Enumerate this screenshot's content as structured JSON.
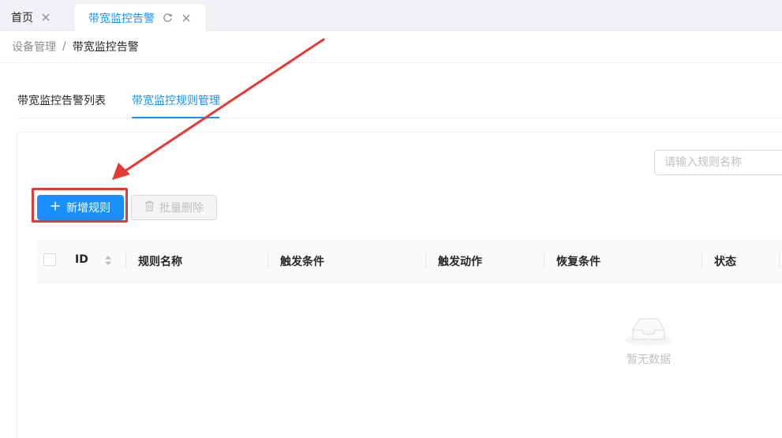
{
  "tabs": [
    {
      "label": "首页"
    },
    {
      "label": "带宽监控告警"
    }
  ],
  "breadcrumb": {
    "parent": "设备管理",
    "separator": "/",
    "current": "带宽监控告警"
  },
  "inner_tabs": [
    {
      "label": "带宽监控告警列表",
      "active": false
    },
    {
      "label": "带宽监控规则管理",
      "active": true
    }
  ],
  "toolbar": {
    "search_placeholder": "请输入规则名称",
    "add_label": "新增规则",
    "batch_delete_label": "批量删除"
  },
  "table": {
    "columns": [
      "ID",
      "规则名称",
      "触发条件",
      "触发动作",
      "恢复条件",
      "状态"
    ],
    "rows": [],
    "empty_text": "暂无数据"
  },
  "icons": {
    "close": "close-icon",
    "reload": "reload-icon",
    "plus": "plus-icon",
    "trash": "trash-icon",
    "sort": "sort-icon",
    "empty": "empty-inbox-icon"
  },
  "colors": {
    "primary": "#1890ff",
    "annotation": "#e53935"
  }
}
